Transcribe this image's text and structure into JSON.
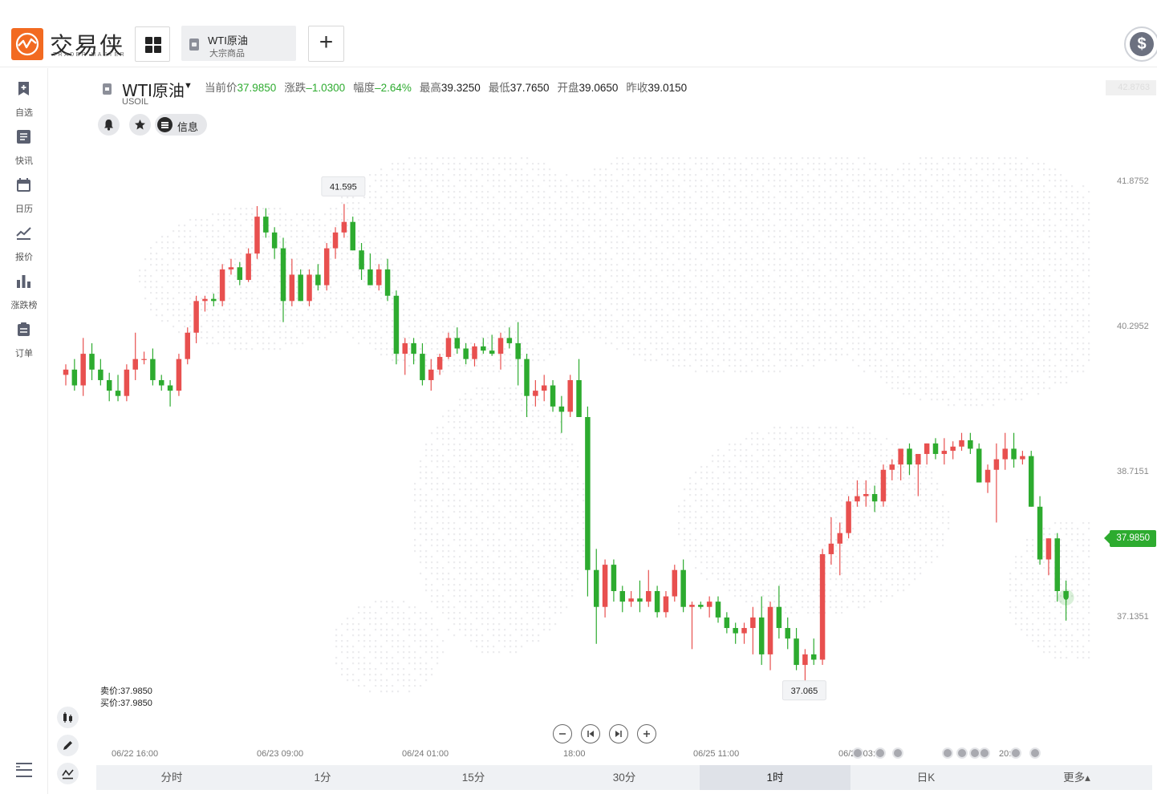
{
  "app": {
    "logo_text": "交易侠",
    "logo_sub": "TRADER MASTER",
    "tab": {
      "title": "WTI原油",
      "subtitle": "大宗商品"
    },
    "add_label": "+",
    "account_icon": "dollar-icon"
  },
  "sidebar": {
    "items": [
      {
        "label": "自选",
        "icon": "bookmark-plus-icon"
      },
      {
        "label": "快讯",
        "icon": "news-list-icon"
      },
      {
        "label": "日历",
        "icon": "calendar-icon"
      },
      {
        "label": "报价",
        "icon": "line-chart-icon"
      },
      {
        "label": "涨跌榜",
        "icon": "bar-chart-icon"
      },
      {
        "label": "订单",
        "icon": "clipboard-icon"
      }
    ]
  },
  "quote": {
    "name": "WTI原油",
    "code": "USOIL",
    "current_label": "当前价",
    "current": "37.9850",
    "change_label": "涨跌",
    "change": "–1.0300",
    "pct_label": "幅度",
    "pct": "–2.64%",
    "high_label": "最高",
    "high": "39.3250",
    "low_label": "最低",
    "low": "37.7650",
    "open_label": "开盘",
    "open": "39.0650",
    "prev_label": "昨收",
    "prev": "39.0150"
  },
  "actions": {
    "info_label": "信息"
  },
  "sell_buy": {
    "sell": "卖价:37.9850",
    "buy": "买价:37.9850"
  },
  "periods": [
    "分时",
    "1分",
    "15分",
    "30分",
    "1时",
    "日K",
    "更多▴"
  ],
  "active_period": "1时",
  "colors": {
    "up": "#e8504f",
    "down": "#2dab2f",
    "accent": "#f26a21"
  },
  "chart_data": {
    "type": "candlestick",
    "symbol": "WTI原油",
    "x_tick_labels": [
      "06/22 16:00",
      "06/23 09:00",
      "06/24 01:00",
      "18:00",
      "06/25 11:00",
      "06/26 03:00",
      "20:00"
    ],
    "y_tick_labels": [
      "42.8763",
      "41.8752",
      "40.2952",
      "38.7151",
      "37.1351"
    ],
    "ylim": [
      36.4,
      43.0
    ],
    "current_price": "37.9850",
    "max_marker": "41.595",
    "min_marker": "37.065",
    "candles": [
      [
        40.1,
        40.2,
        40.0,
        40.15
      ],
      [
        40.15,
        40.25,
        39.95,
        40.0
      ],
      [
        40.0,
        40.45,
        39.9,
        40.3
      ],
      [
        40.3,
        40.4,
        40.05,
        40.15
      ],
      [
        40.15,
        40.25,
        40.0,
        40.05
      ],
      [
        40.05,
        40.12,
        39.85,
        39.95
      ],
      [
        39.95,
        40.1,
        39.85,
        39.9
      ],
      [
        39.9,
        40.2,
        39.85,
        40.15
      ],
      [
        40.15,
        40.5,
        40.05,
        40.25
      ],
      [
        40.25,
        40.32,
        40.2,
        40.25
      ],
      [
        40.25,
        40.35,
        40.0,
        40.05
      ],
      [
        40.05,
        40.1,
        39.95,
        40.0
      ],
      [
        40.0,
        40.05,
        39.8,
        39.95
      ],
      [
        39.95,
        40.3,
        39.9,
        40.25
      ],
      [
        40.25,
        40.55,
        40.2,
        40.5
      ],
      [
        40.5,
        40.85,
        40.4,
        40.8
      ],
      [
        40.8,
        40.85,
        40.7,
        40.82
      ],
      [
        40.82,
        40.87,
        40.75,
        40.8
      ],
      [
        40.8,
        41.15,
        40.75,
        41.1
      ],
      [
        41.1,
        41.2,
        41.05,
        41.12
      ],
      [
        41.12,
        41.17,
        40.95,
        41.0
      ],
      [
        41.0,
        41.3,
        40.98,
        41.25
      ],
      [
        41.25,
        41.7,
        41.2,
        41.6
      ],
      [
        41.6,
        41.68,
        41.4,
        41.45
      ],
      [
        41.45,
        41.5,
        41.2,
        41.3
      ],
      [
        41.3,
        41.4,
        40.6,
        40.8
      ],
      [
        40.8,
        41.2,
        40.75,
        41.05
      ],
      [
        41.05,
        41.1,
        40.8,
        40.8
      ],
      [
        40.8,
        41.1,
        40.75,
        41.05
      ],
      [
        41.05,
        41.15,
        40.9,
        40.95
      ],
      [
        40.95,
        41.35,
        40.9,
        41.3
      ],
      [
        41.3,
        41.5,
        41.2,
        41.45
      ],
      [
        41.45,
        41.72,
        41.4,
        41.55
      ],
      [
        41.55,
        41.6,
        41.28,
        41.28
      ],
      [
        41.28,
        41.35,
        41.0,
        41.1
      ],
      [
        41.1,
        41.25,
        40.95,
        40.95
      ],
      [
        40.95,
        41.15,
        40.9,
        41.1
      ],
      [
        41.1,
        41.2,
        40.8,
        40.85
      ],
      [
        40.85,
        40.9,
        40.2,
        40.3
      ],
      [
        40.3,
        40.45,
        40.1,
        40.4
      ],
      [
        40.4,
        40.45,
        40.2,
        40.3
      ],
      [
        40.3,
        40.4,
        40.0,
        40.05
      ],
      [
        40.05,
        40.25,
        39.95,
        40.15
      ],
      [
        40.15,
        40.3,
        40.1,
        40.27
      ],
      [
        40.27,
        40.5,
        40.25,
        40.45
      ],
      [
        40.45,
        40.55,
        40.3,
        40.35
      ],
      [
        40.35,
        40.4,
        40.2,
        40.25
      ],
      [
        40.25,
        40.4,
        40.18,
        40.37
      ],
      [
        40.37,
        40.45,
        40.3,
        40.33
      ],
      [
        40.33,
        40.48,
        40.28,
        40.3
      ],
      [
        40.3,
        40.5,
        40.15,
        40.45
      ],
      [
        40.45,
        40.55,
        40.35,
        40.4
      ],
      [
        40.4,
        40.6,
        40.0,
        40.25
      ],
      [
        40.25,
        40.3,
        39.7,
        39.9
      ],
      [
        39.9,
        40.05,
        39.8,
        39.95
      ],
      [
        39.95,
        40.1,
        39.85,
        40.0
      ],
      [
        40.0,
        40.05,
        39.75,
        39.8
      ],
      [
        39.8,
        39.9,
        39.55,
        39.75
      ],
      [
        39.75,
        40.1,
        39.7,
        40.05
      ],
      [
        40.05,
        40.25,
        39.7,
        39.7
      ],
      [
        39.7,
        39.8,
        38.0,
        38.25
      ],
      [
        38.25,
        38.45,
        37.55,
        37.9
      ],
      [
        37.9,
        38.35,
        37.8,
        38.3
      ],
      [
        38.3,
        38.35,
        37.95,
        38.05
      ],
      [
        38.05,
        38.1,
        37.85,
        37.95
      ],
      [
        37.95,
        38.05,
        37.9,
        37.98
      ],
      [
        37.98,
        38.15,
        37.85,
        37.95
      ],
      [
        37.95,
        38.25,
        37.9,
        38.05
      ],
      [
        38.05,
        38.1,
        37.8,
        37.85
      ],
      [
        37.85,
        38.05,
        37.8,
        38.0
      ],
      [
        38.0,
        38.3,
        37.95,
        38.25
      ],
      [
        38.25,
        38.35,
        37.85,
        37.9
      ],
      [
        37.9,
        37.95,
        37.5,
        37.92
      ],
      [
        37.92,
        37.95,
        37.88,
        37.9
      ],
      [
        37.9,
        38.0,
        37.8,
        37.95
      ],
      [
        37.95,
        38.0,
        37.75,
        37.8
      ],
      [
        37.8,
        37.85,
        37.65,
        37.7
      ],
      [
        37.7,
        37.75,
        37.55,
        37.65
      ],
      [
        37.65,
        37.75,
        37.55,
        37.7
      ],
      [
        37.7,
        37.9,
        37.45,
        37.8
      ],
      [
        37.8,
        38.0,
        37.35,
        37.45
      ],
      [
        37.45,
        37.95,
        37.3,
        37.9
      ],
      [
        37.9,
        38.1,
        37.6,
        37.7
      ],
      [
        37.7,
        37.8,
        37.5,
        37.6
      ],
      [
        37.6,
        37.7,
        37.3,
        37.35
      ],
      [
        37.35,
        37.5,
        37.2,
        37.45
      ],
      [
        37.45,
        37.6,
        37.35,
        37.4
      ],
      [
        37.4,
        38.45,
        37.35,
        38.4
      ],
      [
        38.4,
        38.75,
        38.3,
        38.5
      ],
      [
        38.5,
        38.7,
        38.2,
        38.6
      ],
      [
        38.6,
        38.95,
        38.55,
        38.9
      ],
      [
        38.9,
        39.1,
        38.85,
        38.95
      ],
      [
        38.95,
        39.1,
        38.85,
        38.97
      ],
      [
        38.97,
        39.05,
        38.8,
        38.9
      ],
      [
        38.9,
        39.25,
        38.85,
        39.2
      ],
      [
        39.2,
        39.3,
        39.1,
        39.25
      ],
      [
        39.25,
        39.35,
        39.1,
        39.4
      ],
      [
        39.4,
        39.45,
        39.15,
        39.25
      ],
      [
        39.25,
        39.3,
        38.95,
        39.35
      ],
      [
        39.35,
        39.45,
        39.25,
        39.45
      ],
      [
        39.45,
        39.5,
        39.3,
        39.35
      ],
      [
        39.35,
        39.5,
        39.25,
        39.38
      ],
      [
        39.38,
        39.47,
        39.3,
        39.42
      ],
      [
        39.42,
        39.55,
        39.38,
        39.48
      ],
      [
        39.48,
        39.55,
        39.35,
        39.4
      ],
      [
        39.4,
        39.45,
        39.08,
        39.08
      ],
      [
        39.08,
        39.25,
        38.98,
        39.2
      ],
      [
        39.2,
        39.45,
        38.7,
        39.3
      ],
      [
        39.3,
        39.55,
        39.2,
        39.4
      ],
      [
        39.4,
        39.55,
        39.22,
        39.3
      ],
      [
        39.3,
        39.38,
        39.25,
        39.33
      ],
      [
        39.33,
        39.38,
        38.85,
        38.85
      ],
      [
        38.85,
        38.95,
        38.3,
        38.35
      ],
      [
        38.35,
        38.55,
        38.2,
        38.55
      ],
      [
        38.55,
        38.6,
        37.95,
        38.05
      ],
      [
        38.05,
        38.15,
        37.77,
        37.99
      ]
    ]
  }
}
